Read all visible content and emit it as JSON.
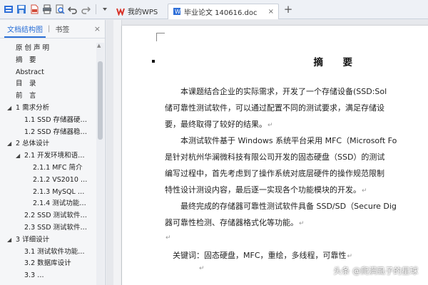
{
  "quick_access": {
    "icons": [
      "wps-menu-icon",
      "save-icon",
      "export-pdf-icon",
      "print-icon",
      "print-preview-icon",
      "undo-icon",
      "redo-icon",
      "dropdown-arrow-icon"
    ]
  },
  "tabs": [
    {
      "label": "我的WPS",
      "icon": "wps-logo-icon"
    },
    {
      "label": "毕业论文 140616.doc",
      "icon": "document-icon",
      "close": "×"
    }
  ],
  "new_tab": "+",
  "nav_panel": {
    "tab_outline": "文档结构图",
    "tab_separator": "|",
    "tab_bookmarks": "书签",
    "close": "×",
    "items": [
      {
        "label": "原 创 声 明",
        "level": 0,
        "arrow": ""
      },
      {
        "label": "摘　要",
        "level": 0,
        "arrow": ""
      },
      {
        "label": "Abstract",
        "level": 0,
        "arrow": ""
      },
      {
        "label": "目　录",
        "level": 0,
        "arrow": ""
      },
      {
        "label": "前　言",
        "level": 0,
        "arrow": ""
      },
      {
        "label": "1 需求分析",
        "level": 0,
        "arrow": "◢"
      },
      {
        "label": "1.1 SSD 存储器硬…",
        "level": 1,
        "arrow": ""
      },
      {
        "label": "1.2 SSD 存储器稳…",
        "level": 1,
        "arrow": ""
      },
      {
        "label": "2 总体设计",
        "level": 0,
        "arrow": "◢"
      },
      {
        "label": "2.1 开发环境和语…",
        "level": 1,
        "arrow": "◢"
      },
      {
        "label": "2.1.1 MFC 简介",
        "level": 2,
        "arrow": ""
      },
      {
        "label": "2.1.2 VS2010 …",
        "level": 2,
        "arrow": ""
      },
      {
        "label": "2.1.3 MySQL …",
        "level": 2,
        "arrow": ""
      },
      {
        "label": "2.1.4 测试功能…",
        "level": 2,
        "arrow": ""
      },
      {
        "label": "2.2 SSD 测试软件…",
        "level": 1,
        "arrow": ""
      },
      {
        "label": "2.3 SSD 测试软件…",
        "level": 1,
        "arrow": ""
      },
      {
        "label": "3 详细设计",
        "level": 0,
        "arrow": "◢"
      },
      {
        "label": "3.1 测试软件功能…",
        "level": 1,
        "arrow": ""
      },
      {
        "label": "3.2 数据库设计",
        "level": 1,
        "arrow": ""
      },
      {
        "label": "3.3 …",
        "level": 1,
        "arrow": ""
      }
    ]
  },
  "document": {
    "title": "摘　要",
    "paragraphs": [
      "　　本课题结合企业的实际需求，开发了一个存储设备(SSD:Sol",
      "储可靠性测试软件，可以通过配置不同的测试要求，满足存储设",
      "要，最终取得了较好的结果。",
      "　　本测试软件基于 Windows 系统平台采用 MFC（Microsoft Fo",
      "是针对杭州华澜微科技有限公司开发的固态硬盘（SSD）的测试",
      "编写过程中，首先考虑到了操作系统对底层硬件的操作规范限制",
      "特性设计测设内容，最后逐一实现各个功能模块的开发。",
      "　　最终完成的存储器可靠性测试软件具备 SSD/SD（Secure Dig",
      "器可靠性检测、存储器格式化等功能。",
      "",
      "　关键词：固态硬盘，MFC，重绘，多线程，可靠性"
    ],
    "paragraph_marks": [
      false,
      false,
      true,
      false,
      false,
      false,
      true,
      false,
      true,
      true,
      true
    ],
    "paragraph_mark": "↵"
  },
  "watermark": "头条 @爬满虱子的星球"
}
